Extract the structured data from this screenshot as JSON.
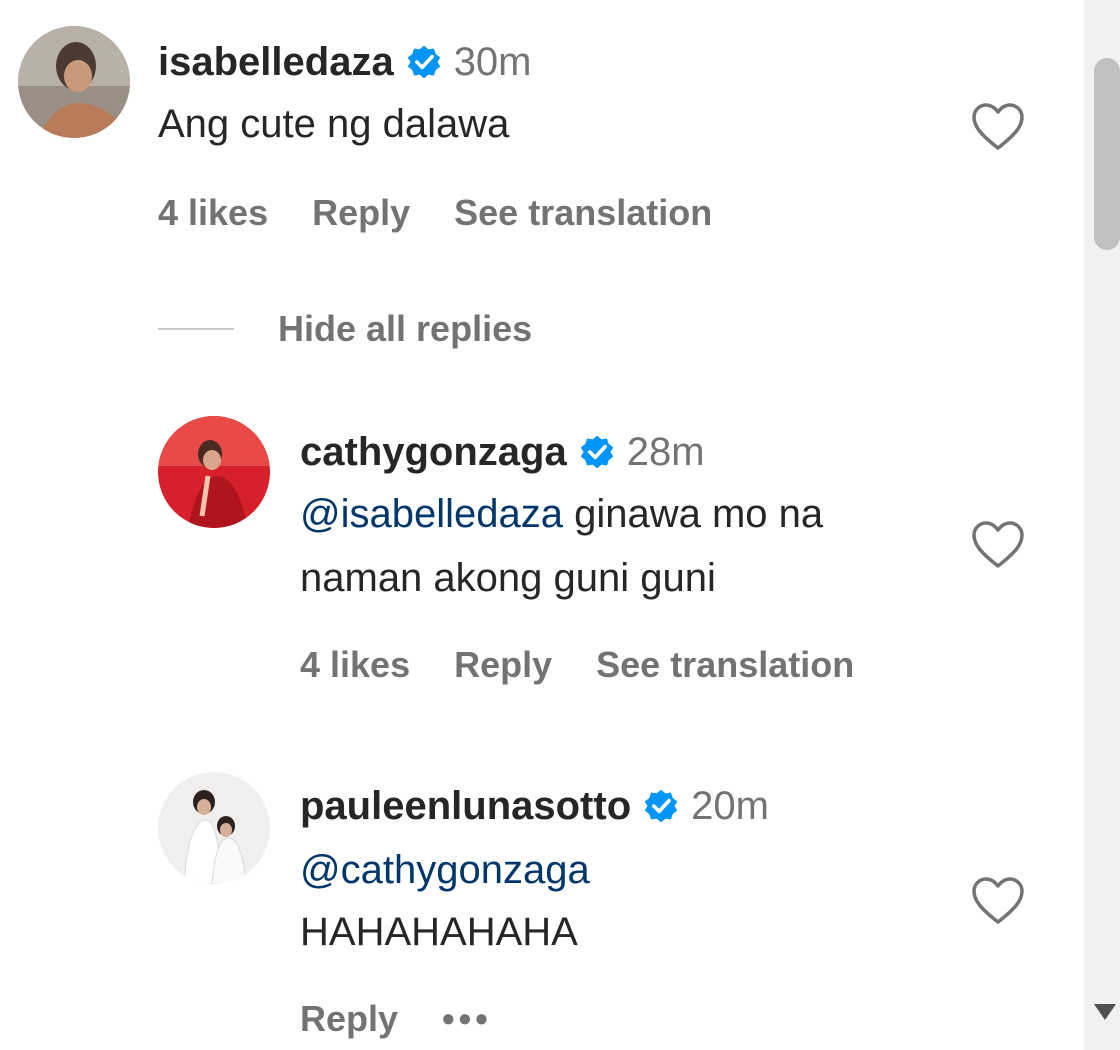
{
  "comments": [
    {
      "username": "isabelledaza",
      "verified": true,
      "time": "30m",
      "text": "Ang cute ng dalawa",
      "likes": "4 likes",
      "reply": "Reply",
      "translate": "See translation"
    },
    {
      "username": "cathygonzaga",
      "verified": true,
      "time": "28m",
      "mention": "@isabelledaza",
      "text_line1": " ginawa mo na",
      "text_line2": "naman akong guni guni",
      "likes": "4 likes",
      "reply": "Reply",
      "translate": "See translation"
    },
    {
      "username": "pauleenlunasotto",
      "verified": true,
      "time": "20m",
      "mention": "@cathygonzaga",
      "text": "HAHAHAHAHA",
      "reply": "Reply",
      "more": "•••"
    }
  ],
  "hide_replies": "Hide all replies",
  "colors": {
    "verified": "#0095f6",
    "mention": "#00376b",
    "secondary": "#737373"
  }
}
